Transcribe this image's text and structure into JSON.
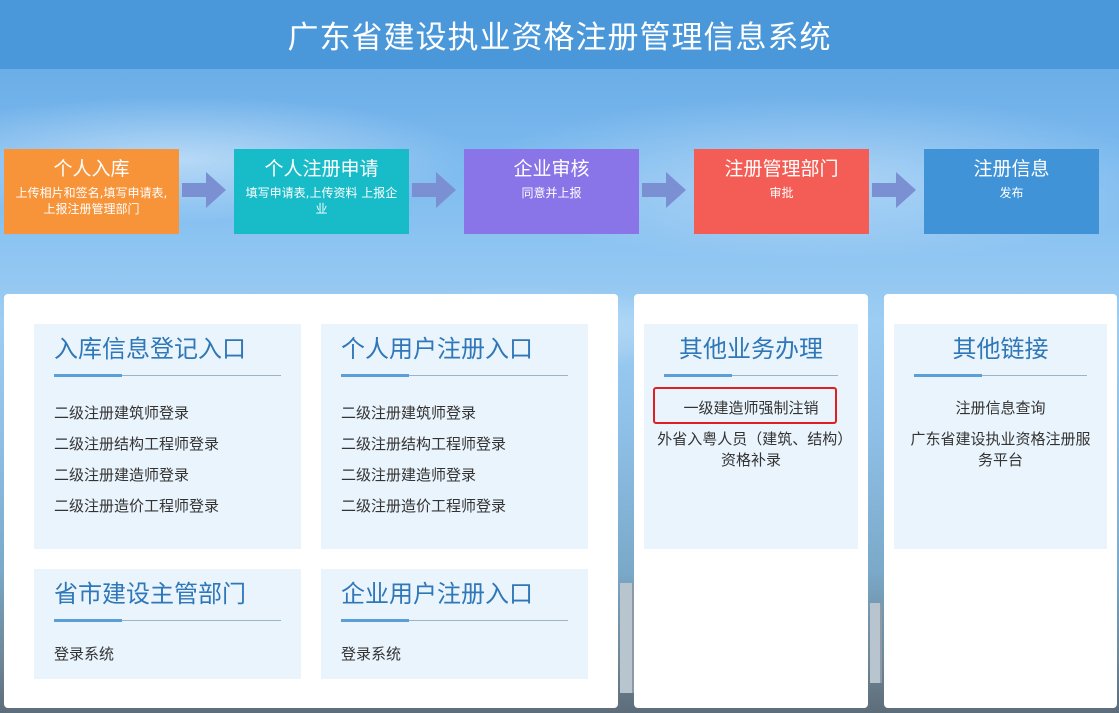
{
  "header": {
    "title": "广东省建设执业资格注册管理信息系统"
  },
  "steps": [
    {
      "title": "个人入库",
      "desc": "上传相片和签名,填写申请表,上报注册管理部门",
      "color": "#f7943a"
    },
    {
      "title": "个人注册申请",
      "desc": "填写申请表,上传资料 上报企业",
      "color": "#18bcc8"
    },
    {
      "title": "企业审核",
      "desc": "同意并上报",
      "color": "#8974e8"
    },
    {
      "title": "注册管理部门",
      "desc": "审批",
      "color": "#f45d55"
    },
    {
      "title": "注册信息",
      "desc": "发布",
      "color": "#3f93d6"
    }
  ],
  "sections": {
    "ruku": {
      "title": "入库信息登记入口",
      "links": [
        "二级注册建筑师登录",
        "二级注册结构工程师登录",
        "二级注册建造师登录",
        "二级注册造价工程师登录"
      ]
    },
    "geren": {
      "title": "个人用户注册入口",
      "links": [
        "二级注册建筑师登录",
        "二级注册结构工程师登录",
        "二级注册建造师登录",
        "二级注册造价工程师登录"
      ]
    },
    "shengshi": {
      "title": "省市建设主管部门",
      "link": "登录系统"
    },
    "qiye": {
      "title": "企业用户注册入口",
      "link": "登录系统"
    },
    "other_biz": {
      "title": "其他业务办理",
      "links": [
        "一级建造师强制注销",
        "外省入粤人员（建筑、结构）资格补录"
      ]
    },
    "other_links": {
      "title": "其他链接",
      "links": [
        "注册信息查询",
        "广东省建设执业资格注册服务平台"
      ]
    }
  }
}
